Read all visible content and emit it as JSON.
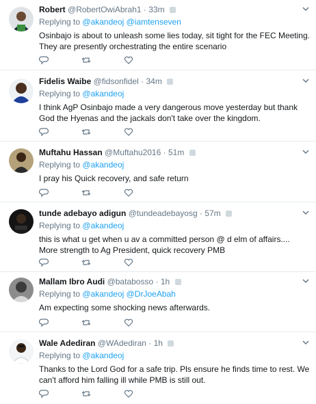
{
  "replying_prefix": "Replying to",
  "tweets": [
    {
      "name": "Robert",
      "handle": "@RobertOwiAbrah1",
      "time": "33m",
      "mentions": [
        "@akandeoj",
        "@iamtenseven"
      ],
      "text": "Osinbajo is about to unleash some lies today, sit tight for the FEC Meeting. They are presently orchestrating the entire scenario"
    },
    {
      "name": "Fidelis Waibe",
      "handle": "@fidsonfidel",
      "time": "34m",
      "mentions": [
        "@akandeoj"
      ],
      "text": "I think AgP Osinbajo made a very dangerous move yesterday but thank God the Hyenas and the jackals don't take over the kingdom."
    },
    {
      "name": "Muftahu Hassan",
      "handle": "@Muftahu2016",
      "time": "51m",
      "mentions": [
        "@akandeoj"
      ],
      "text": "I pray his Quick recovery, and safe return"
    },
    {
      "name": "tunde adebayo adigun",
      "handle": "@tundeadebayosg",
      "time": "57m",
      "mentions": [
        "@akandeoj"
      ],
      "text": "this is what u get when u av a committed person @ d elm of affairs.... More strength to Ag President, quick recovery PMB"
    },
    {
      "name": "Mallam Ibro Audi",
      "handle": "@batabosso",
      "time": "1h",
      "mentions": [
        "@akandeoj",
        "@DrJoeAbah"
      ],
      "text": "Am expecting some shocking news afterwards."
    },
    {
      "name": "Wale Adediran",
      "handle": "@WAdediran",
      "time": "1h",
      "mentions": [
        "@akandeoj"
      ],
      "text": "Thanks to the Lord God for a safe trip. Pls ensure he finds time to rest. We can't afford him falling ill while PMB is still out."
    }
  ],
  "icons": {
    "reply": "reply-icon",
    "retweet": "retweet-icon",
    "like": "heart-icon",
    "more": "chevron-down-icon"
  },
  "colors": {
    "link": "#1da1f2",
    "secondary_text": "#657786",
    "divider": "#e6ecf0"
  }
}
